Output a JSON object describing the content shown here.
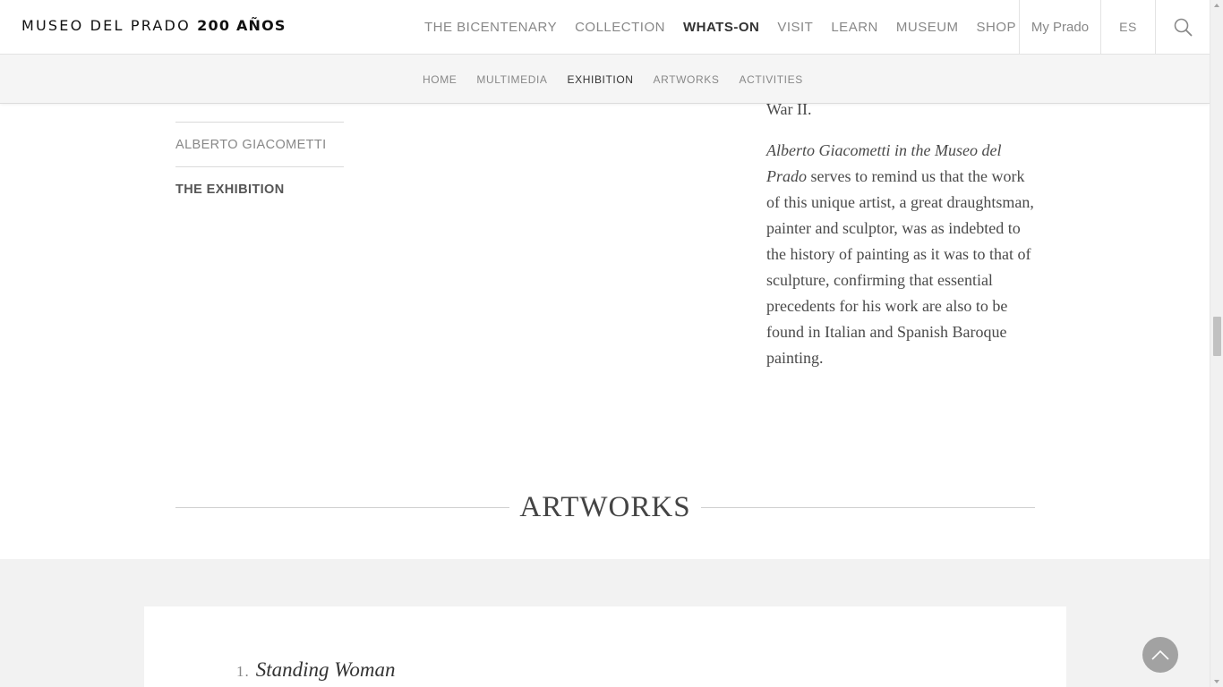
{
  "header": {
    "logo_text": "MUSEO DEL PRADO",
    "logo_strong": "200 AÑOS",
    "nav": [
      {
        "label": "THE BICENTENARY",
        "active": false
      },
      {
        "label": "COLLECTION",
        "active": false
      },
      {
        "label": "WHATS-ON",
        "active": true
      },
      {
        "label": "VISIT",
        "active": false
      },
      {
        "label": "LEARN",
        "active": false
      },
      {
        "label": "MUSEUM",
        "active": false
      },
      {
        "label": "SHOP",
        "active": false
      }
    ],
    "my_prado": "My Prado",
    "language": "ES",
    "search_icon": "search-icon"
  },
  "subnav": {
    "items": [
      {
        "label": "HOME",
        "active": false
      },
      {
        "label": "MULTIMEDIA",
        "active": false
      },
      {
        "label": "EXHIBITION",
        "active": true
      },
      {
        "label": "ARTWORKS",
        "active": false
      },
      {
        "label": "ACTIVITIES",
        "active": false
      }
    ]
  },
  "sidebar": {
    "items": [
      {
        "label": "ALBERTO GIACOMETTI",
        "active": false
      },
      {
        "label": "THE EXHIBITION",
        "active": true
      }
    ]
  },
  "content": {
    "partial_line": "War II.",
    "paragraph_italic": "Alberto Giacometti in the Museo del Prado",
    "paragraph_rest": "serves to remind us that the work of this unique artist, a great draughtsman, painter and sculptor, was as indebted to the history of painting as it was to that of sculpture, confirming that essential precedents for his work are also to be found in Italian and Spanish Baroque painting."
  },
  "artworks": {
    "heading": "ARTWORKS",
    "items": [
      {
        "number": "1.",
        "title": "Standing Woman"
      }
    ]
  },
  "controls": {
    "back_to_top_icon": "chevron-up-icon"
  },
  "colors": {
    "text_muted": "#888888",
    "text_dark": "#333333",
    "band_bg": "#f2f2f2",
    "subnav_bg": "#f5f5f5"
  }
}
